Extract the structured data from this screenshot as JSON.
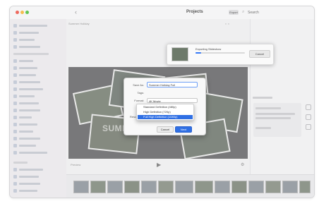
{
  "window": {
    "title": "Projects",
    "toolbar_button": "Export",
    "search_placeholder": "Search"
  },
  "main": {
    "header_label": "Summer Holiday",
    "project_title": "SUMMER HOLIDAY",
    "player_label": "Preview"
  },
  "export_progress": {
    "label": "Exporting Slideshow",
    "progress_percent": 12,
    "cancel_label": "Cancel"
  },
  "export_dialog": {
    "save_as_label": "Save As:",
    "save_as_value": "Summer Holiday Full",
    "tags_label": "Tags:",
    "format_label": "Format:",
    "format_value": "4K Movie",
    "resolution_label": "Resolution:",
    "options": [
      "Standard Definition (480p)",
      "High Definition (720p)",
      "Full High Definition (1080p)"
    ],
    "selected_option_index": 2,
    "cancel_label": "Cancel",
    "next_label": "Next"
  }
}
